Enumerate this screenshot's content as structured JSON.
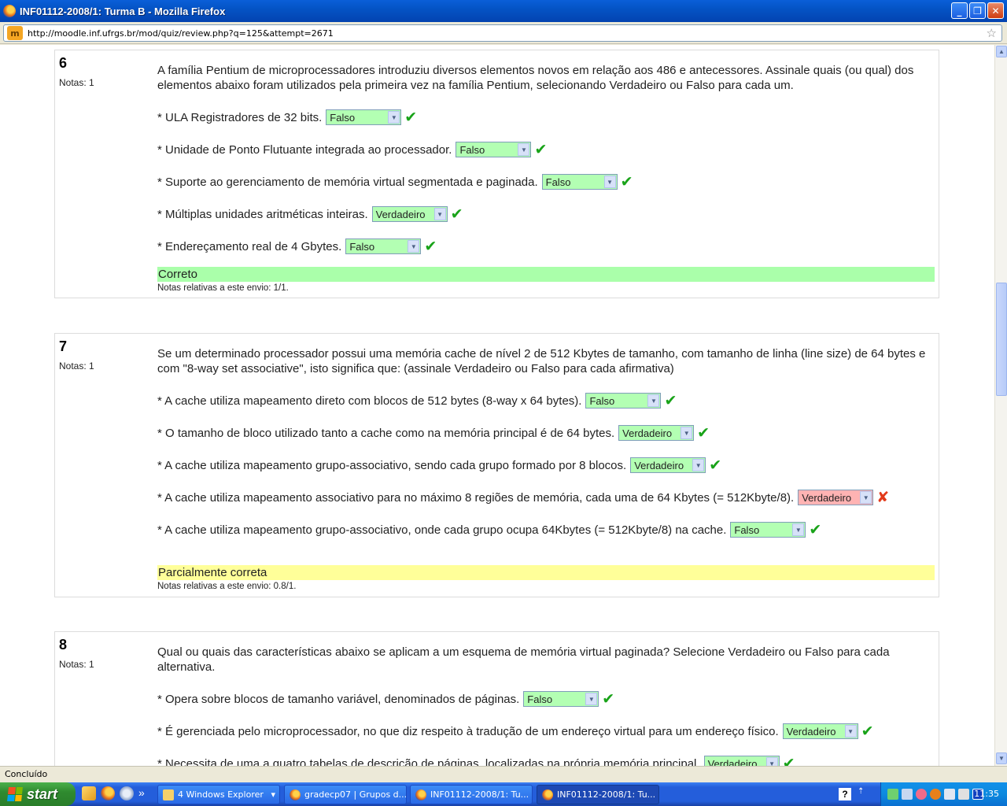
{
  "window": {
    "title": "INF01112-2008/1: Turma B - Mozilla Firefox",
    "minimize": "_",
    "maximize": "❐",
    "close": "✕"
  },
  "address": {
    "url": "http://moodle.inf.ufrgs.br/mod/quiz/review.php?q=125&attempt=2671",
    "site_icon": "moodle-icon",
    "site_icon_glyph": "m"
  },
  "questions": [
    {
      "number": "6",
      "grade_label": "Notas: 1",
      "text": "A família Pentium de microprocessadores introduziu diversos elementos novos em relação aos 486 e antecessores. Assinale quais (ou qual) dos elementos abaixo foram utilizados pela primeira vez na família Pentium, selecionando Verdadeiro ou Falso para cada um.",
      "items": [
        {
          "text": "* ULA Registradores de 32 bits.",
          "answer": "Falso",
          "correct": true
        },
        {
          "text": "* Unidade de Ponto Flutuante integrada ao processador.",
          "answer": "Falso",
          "correct": true
        },
        {
          "text": "* Suporte ao gerenciamento de memória virtual segmentada e paginada.",
          "answer": "Falso",
          "correct": true
        },
        {
          "text": "* Múltiplas unidades aritméticas inteiras.",
          "answer": "Verdadeiro",
          "correct": true
        },
        {
          "text": "* Endereçamento real de 4 Gbytes.",
          "answer": "Falso",
          "correct": true
        }
      ],
      "feedback": "Correto",
      "grade_note": "Notas relativas a este envio: 1/1."
    },
    {
      "number": "7",
      "grade_label": "Notas: 1",
      "text": "Se um determinado processador possui uma memória cache de nível 2 de 512 Kbytes de tamanho, com tamanho de linha (line size) de 64 bytes e com \"8-way set associative\", isto significa que: (assinale Verdadeiro ou Falso para cada afirmativa)",
      "items": [
        {
          "text": "* A cache utiliza mapeamento direto com blocos de 512 bytes (8-way x 64 bytes).",
          "answer": "Falso",
          "correct": true
        },
        {
          "text": "* O tamanho de bloco utilizado tanto a cache como na memória principal é de 64 bytes.",
          "answer": "Verdadeiro",
          "correct": true
        },
        {
          "text": "* A cache utiliza mapeamento grupo-associativo, sendo cada grupo formado por 8 blocos.",
          "answer": "Verdadeiro",
          "correct": true
        },
        {
          "text": "* A cache utiliza mapeamento associativo para no máximo 8 regiões de memória, cada uma de 64 Kbytes (= 512Kbyte/8).",
          "answer": "Verdadeiro",
          "correct": false
        },
        {
          "text": "* A cache utiliza mapeamento grupo-associativo, onde cada grupo ocupa 64Kbytes (= 512Kbyte/8) na cache.",
          "answer": "Falso",
          "correct": true
        }
      ],
      "feedback": "Parcialmente correta",
      "grade_note": "Notas relativas a este envio: 0.8/1."
    },
    {
      "number": "8",
      "grade_label": "Notas: 1",
      "text": "Qual ou quais das características abaixo se aplicam a um esquema de memória virtual paginada? Selecione Verdadeiro ou Falso para cada alternativa.",
      "items": [
        {
          "text": "* Opera sobre blocos de tamanho variável, denominados de páginas.",
          "answer": "Falso",
          "correct": true
        },
        {
          "text": "* É gerenciada pelo microprocessador, no que diz respeito à tradução de um endereço virtual para um endereço físico.",
          "answer": "Verdadeiro",
          "correct": true
        },
        {
          "text": "* Necessita de uma a quatro tabelas de descrição de páginas, localizadas na própria memória principal.",
          "answer": "Verdadeiro",
          "correct": true
        }
      ]
    }
  ],
  "marks": {
    "correct": "✔",
    "incorrect": "✘"
  },
  "status": {
    "text": "Concluído"
  },
  "taskbar": {
    "start_label": "start",
    "quick_launch_more": "»",
    "tasks": [
      {
        "label": "4 Windows Explorer",
        "icon": "folder-icon",
        "dropdown": "▾"
      },
      {
        "label": "gradecp07 | Grupos d...",
        "icon": "firefox-icon"
      },
      {
        "label": "INF01112-2008/1: Tu...",
        "icon": "firefox-icon"
      },
      {
        "label": "INF01112-2008/1: Tu...",
        "icon": "firefox-icon"
      }
    ],
    "help_glyph": "?",
    "clock": "11:35"
  },
  "colors": {
    "correct_bg": "#b3ffb3",
    "incorrect_bg": "#ffb3b3",
    "feedback_correct": "#aaffaa",
    "feedback_partial": "#ffff99",
    "check_green": "#19a319",
    "cross_red": "#e23a1a"
  }
}
